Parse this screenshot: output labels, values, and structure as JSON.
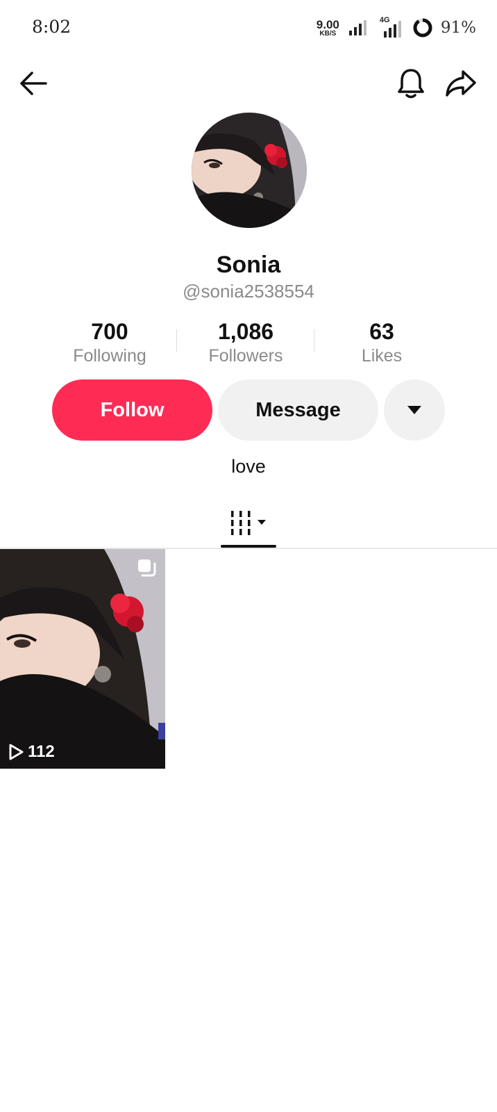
{
  "status_bar": {
    "time": "8:02",
    "net_speed_value": "9.00",
    "net_speed_unit": "KB/S",
    "network_type": "4G",
    "battery": "91%"
  },
  "nav": {
    "back_icon": "arrow-left-icon",
    "bell_icon": "bell-icon",
    "share_icon": "share-icon"
  },
  "profile": {
    "display_name": "Sonia",
    "username": "@sonia2538554",
    "bio": "love"
  },
  "stats": [
    {
      "value": "700",
      "label": "Following"
    },
    {
      "value": "1,086",
      "label": "Followers"
    },
    {
      "value": "63",
      "label": "Likes"
    }
  ],
  "actions": {
    "follow_label": "Follow",
    "message_label": "Message"
  },
  "videos": [
    {
      "views": "112",
      "pinned_icon": "multi-photo-icon"
    }
  ],
  "colors": {
    "accent": "#fe2c55",
    "secondary_button": "#f1f1f2",
    "muted_text": "#8a8a8a"
  }
}
